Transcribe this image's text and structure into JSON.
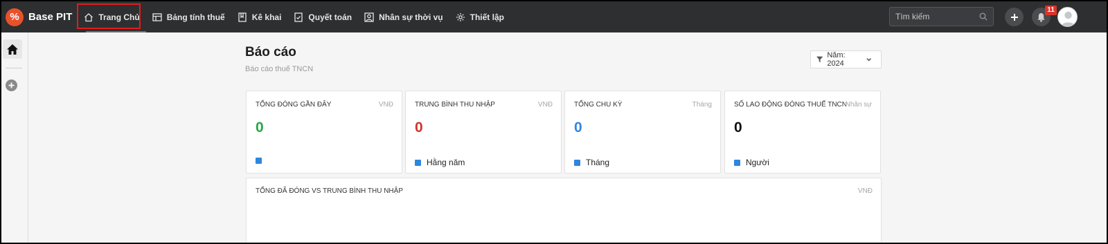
{
  "app": {
    "name": "Base PIT",
    "logo_glyph": "%"
  },
  "nav": [
    {
      "label": "Trang Chủ",
      "icon": "home-icon"
    },
    {
      "label": "Bảng tính thuế",
      "icon": "table-icon"
    },
    {
      "label": "Kê khai",
      "icon": "book-icon"
    },
    {
      "label": "Quyết toán",
      "icon": "checklist-icon"
    },
    {
      "label": "Nhân sự thời vụ",
      "icon": "person-icon"
    },
    {
      "label": "Thiết lập",
      "icon": "gear-icon"
    }
  ],
  "search": {
    "placeholder": "Tìm kiếm"
  },
  "notifications": {
    "count": "11"
  },
  "page": {
    "title": "Báo cáo",
    "subtitle": "Báo cáo thuế TNCN"
  },
  "filter": {
    "label": "Năm: 2024"
  },
  "cards": [
    {
      "title": "TỔNG ĐÓNG GẦN ĐÂY",
      "unit": "VNĐ",
      "value": "0",
      "value_color": "#27a844",
      "legend": ""
    },
    {
      "title": "TRUNG BÌNH THU NHẬP",
      "unit": "VNĐ",
      "value": "0",
      "value_color": "#d0342c",
      "legend": "Hằng năm"
    },
    {
      "title": "TỔNG CHU KỲ",
      "unit": "Tháng",
      "value": "0",
      "value_color": "#2e86de",
      "legend": "Tháng"
    },
    {
      "title": "SỐ LAO ĐỘNG ĐÓNG THUẾ TNCN",
      "unit": "Nhân sự",
      "value": "0",
      "value_color": "#111111",
      "legend": "Người"
    }
  ],
  "chart_card": {
    "title": "TỔNG ĐÃ ĐÓNG VS TRUNG BÌNH THU NHẬP",
    "unit": "VNĐ"
  },
  "colors": {
    "topbar": "#2d2f31",
    "accent": "#e8512a",
    "highlight_box": "#e21c1c",
    "legend_square": "#2e86de"
  }
}
